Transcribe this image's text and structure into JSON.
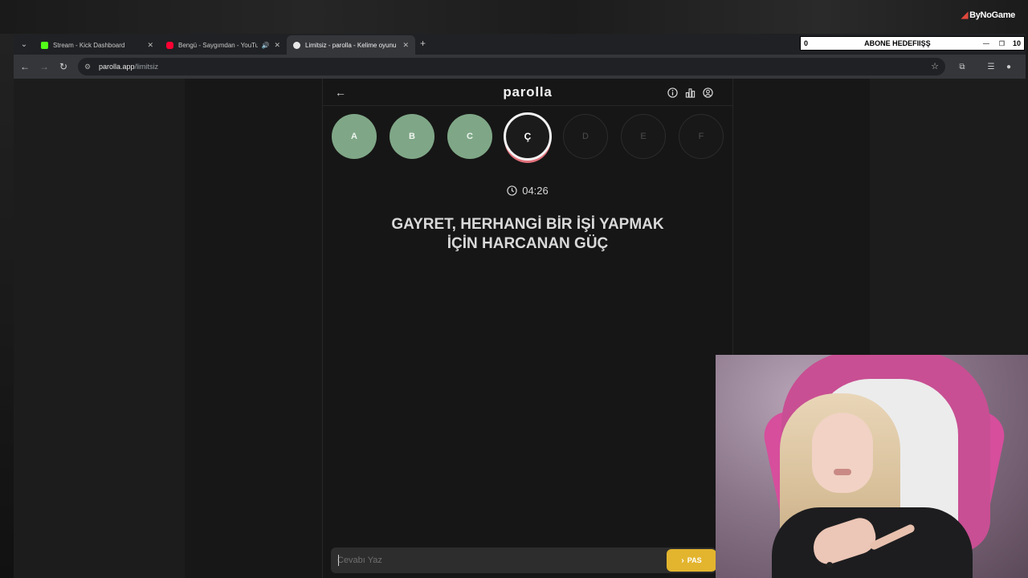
{
  "stream": {
    "brand": "ByNoGame",
    "goal_widget": {
      "current": "0",
      "label": "ABONE HEDEFIIŞŞ",
      "target": "10"
    }
  },
  "browser": {
    "tabs": [
      {
        "title": "Stream - Kick Dashboard",
        "favicon_color": "#53fc18",
        "active": false
      },
      {
        "title": "Bengü - Saygımdan - YouTu",
        "favicon_color": "#ff0033",
        "active": false,
        "audio": true
      },
      {
        "title": "Limitsiz - parolla - Kelime oyunu",
        "favicon_color": "#e8e8e8",
        "active": true
      }
    ],
    "url_host": "parolla.app",
    "url_path": "/limitsiz"
  },
  "game": {
    "logo": "parolla",
    "letters": [
      {
        "letter": "A",
        "state": "done"
      },
      {
        "letter": "B",
        "state": "done"
      },
      {
        "letter": "C",
        "state": "done"
      },
      {
        "letter": "Ç",
        "state": "current"
      },
      {
        "letter": "D",
        "state": "todo"
      },
      {
        "letter": "E",
        "state": "todo"
      },
      {
        "letter": "F",
        "state": "todo"
      }
    ],
    "timer": "04:26",
    "question_line1": "GAYRET, HERHANGİ BİR İŞİ YAPMAK",
    "question_line2": "İÇİN HARCANAN GÜÇ",
    "answer_placeholder": "Cevabı Yaz",
    "pass_label": "PAS"
  },
  "colors": {
    "done_letter": "#7fa787",
    "current_ring": "#f3f3f3",
    "current_shadow": "#e0707a",
    "pass_button": "#e3b52e"
  }
}
